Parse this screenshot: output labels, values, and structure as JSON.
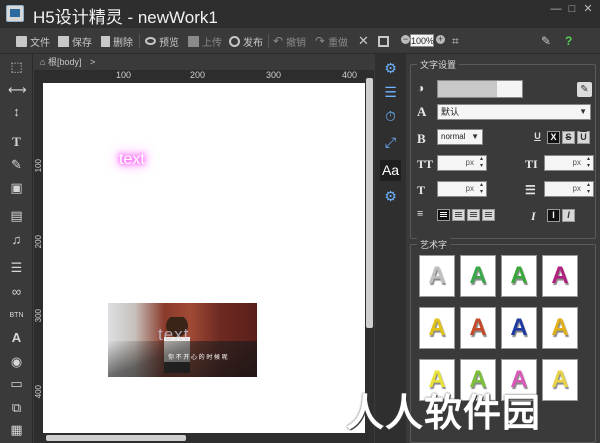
{
  "window": {
    "title": "H5设计精灵 - newWork1",
    "controls": [
      "—",
      "□",
      "✕"
    ]
  },
  "toolbar": {
    "file_label": "文件",
    "save_label": "保存",
    "delete_label": "删除",
    "preview_label": "预览",
    "upload_label": "上传",
    "publish_label": "发布",
    "undo_label": "撤销",
    "redo_label": "重做",
    "zoom_value": "100%"
  },
  "breadcrumb": {
    "text": "根[body]",
    "arrow": ">"
  },
  "rulers": {
    "h_ticks": [
      "100",
      "200",
      "300",
      "400"
    ],
    "v_ticks": [
      "100",
      "200",
      "300",
      "400"
    ]
  },
  "canvas": {
    "glow_text": "text",
    "photo_text": "text",
    "photo_caption": "你 不 开 心 的 时 候 呢"
  },
  "text_settings": {
    "title": "文字设置",
    "font_select": "默认",
    "weight_select": "normal",
    "unit": "px",
    "style_buttons": [
      "U",
      "X",
      "S",
      "U"
    ],
    "italic_buttons": [
      "I",
      "I"
    ]
  },
  "art_text": {
    "title": "艺术字",
    "letter": "A",
    "tiles": [
      {
        "color": "#bfbfbf"
      },
      {
        "color": "#3aa84a"
      },
      {
        "color": "#39a83a"
      },
      {
        "color": "#b2207f"
      },
      {
        "color": "#e0c21a"
      },
      {
        "color": "#c44a2a"
      },
      {
        "color": "#1e3aa0"
      },
      {
        "color": "#e0b01a"
      },
      {
        "color": "#e8e23a"
      },
      {
        "color": "#7ec03a"
      },
      {
        "color": "#d85ab8"
      },
      {
        "color": "#e8d24a"
      }
    ]
  },
  "watermark": {
    "text": "人人软件园"
  }
}
